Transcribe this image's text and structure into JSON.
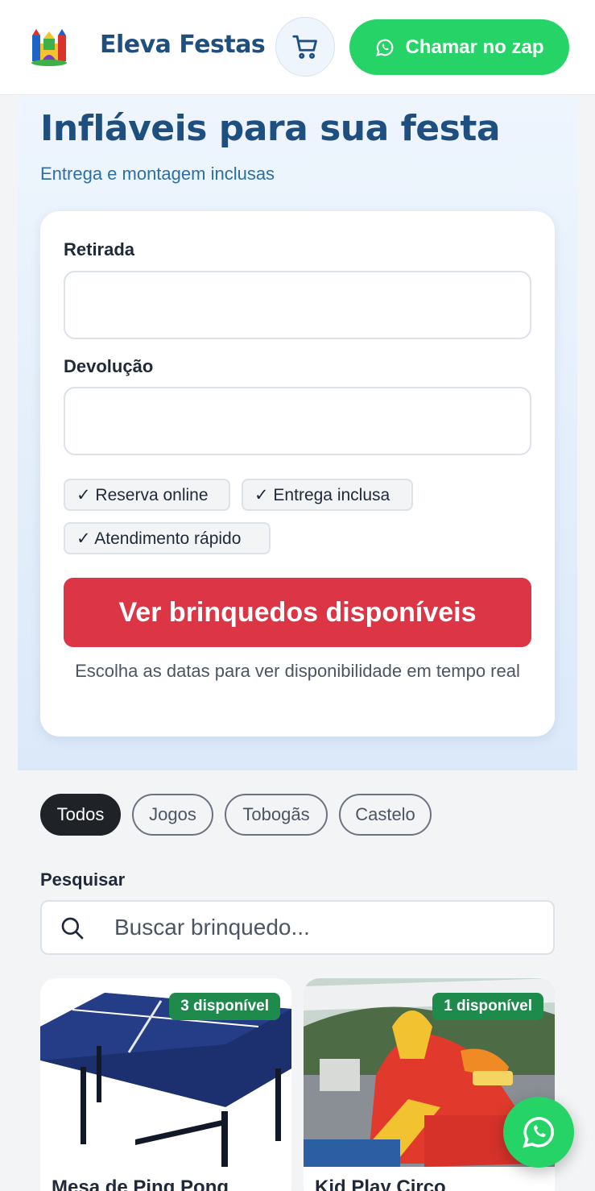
{
  "header": {
    "brand": "Eleva Festas",
    "cart_icon": "cart-icon",
    "whatsapp_label": "Chamar no zap",
    "whatsapp_icon": "whatsapp-icon",
    "accent": "#25d366",
    "brand_color": "#1e4f7e"
  },
  "hero": {
    "title": "Infláveis para sua festa",
    "subtitle": "Entrega e montagem inclusas"
  },
  "booking": {
    "pickup_label": "Retirada",
    "pickup_value": "",
    "return_label": "Devolução",
    "return_value": "",
    "chips": [
      "✓ Reserva online",
      "✓ Entrega inclusa",
      "✓ Atendimento rápido"
    ],
    "cta_label": "Ver brinquedos disponíveis",
    "cta_color": "#dc3545",
    "note": "Escolha as datas para ver disponibilidade em tempo real"
  },
  "filters": {
    "items": [
      "Todos",
      "Jogos",
      "Tobogãs",
      "Castelo"
    ],
    "active": "Todos"
  },
  "search": {
    "label": "Pesquisar",
    "placeholder": "Buscar brinquedo...",
    "value": ""
  },
  "products": [
    {
      "name": "Mesa de Ping Pong",
      "badge": "3 disponível"
    },
    {
      "name": "Kid Play Circo",
      "badge": "1 disponível"
    }
  ],
  "fab": {
    "icon": "whatsapp-icon"
  }
}
